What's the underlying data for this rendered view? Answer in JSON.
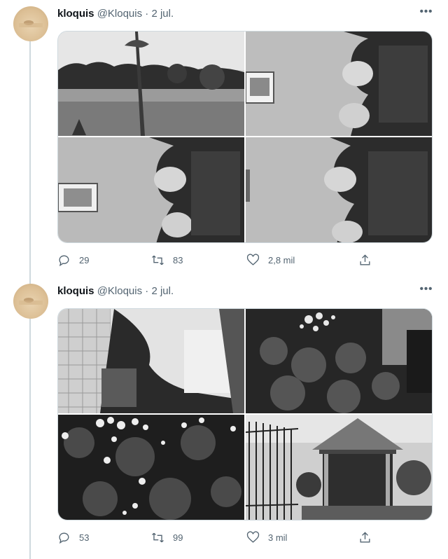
{
  "tweets": [
    {
      "user": {
        "name": "kloquis",
        "handle": "@Kloquis",
        "date": "· 2 jul."
      },
      "stats": {
        "replies": "29",
        "retweets": "83",
        "likes": "2,8 mil"
      },
      "photos": [
        "Paisaje con árbol",
        "Dos hombres junto a un cuadro",
        "Dos hombres junto a un cuadro",
        "Dos hombres junto a un cuadro"
      ]
    },
    {
      "user": {
        "name": "kloquis",
        "handle": "@Kloquis",
        "date": "· 2 jul."
      },
      "stats": {
        "replies": "53",
        "retweets": "99",
        "likes": "3 mil"
      },
      "photos": [
        "Patio con plantas",
        "Arbusto en flor",
        "Flores blancas",
        "Glorieta en el jardín"
      ]
    }
  ],
  "icons": {
    "reply": "reply-icon",
    "retweet": "retweet-icon",
    "like": "like-icon",
    "share": "share-icon",
    "more": "more-icon"
  }
}
